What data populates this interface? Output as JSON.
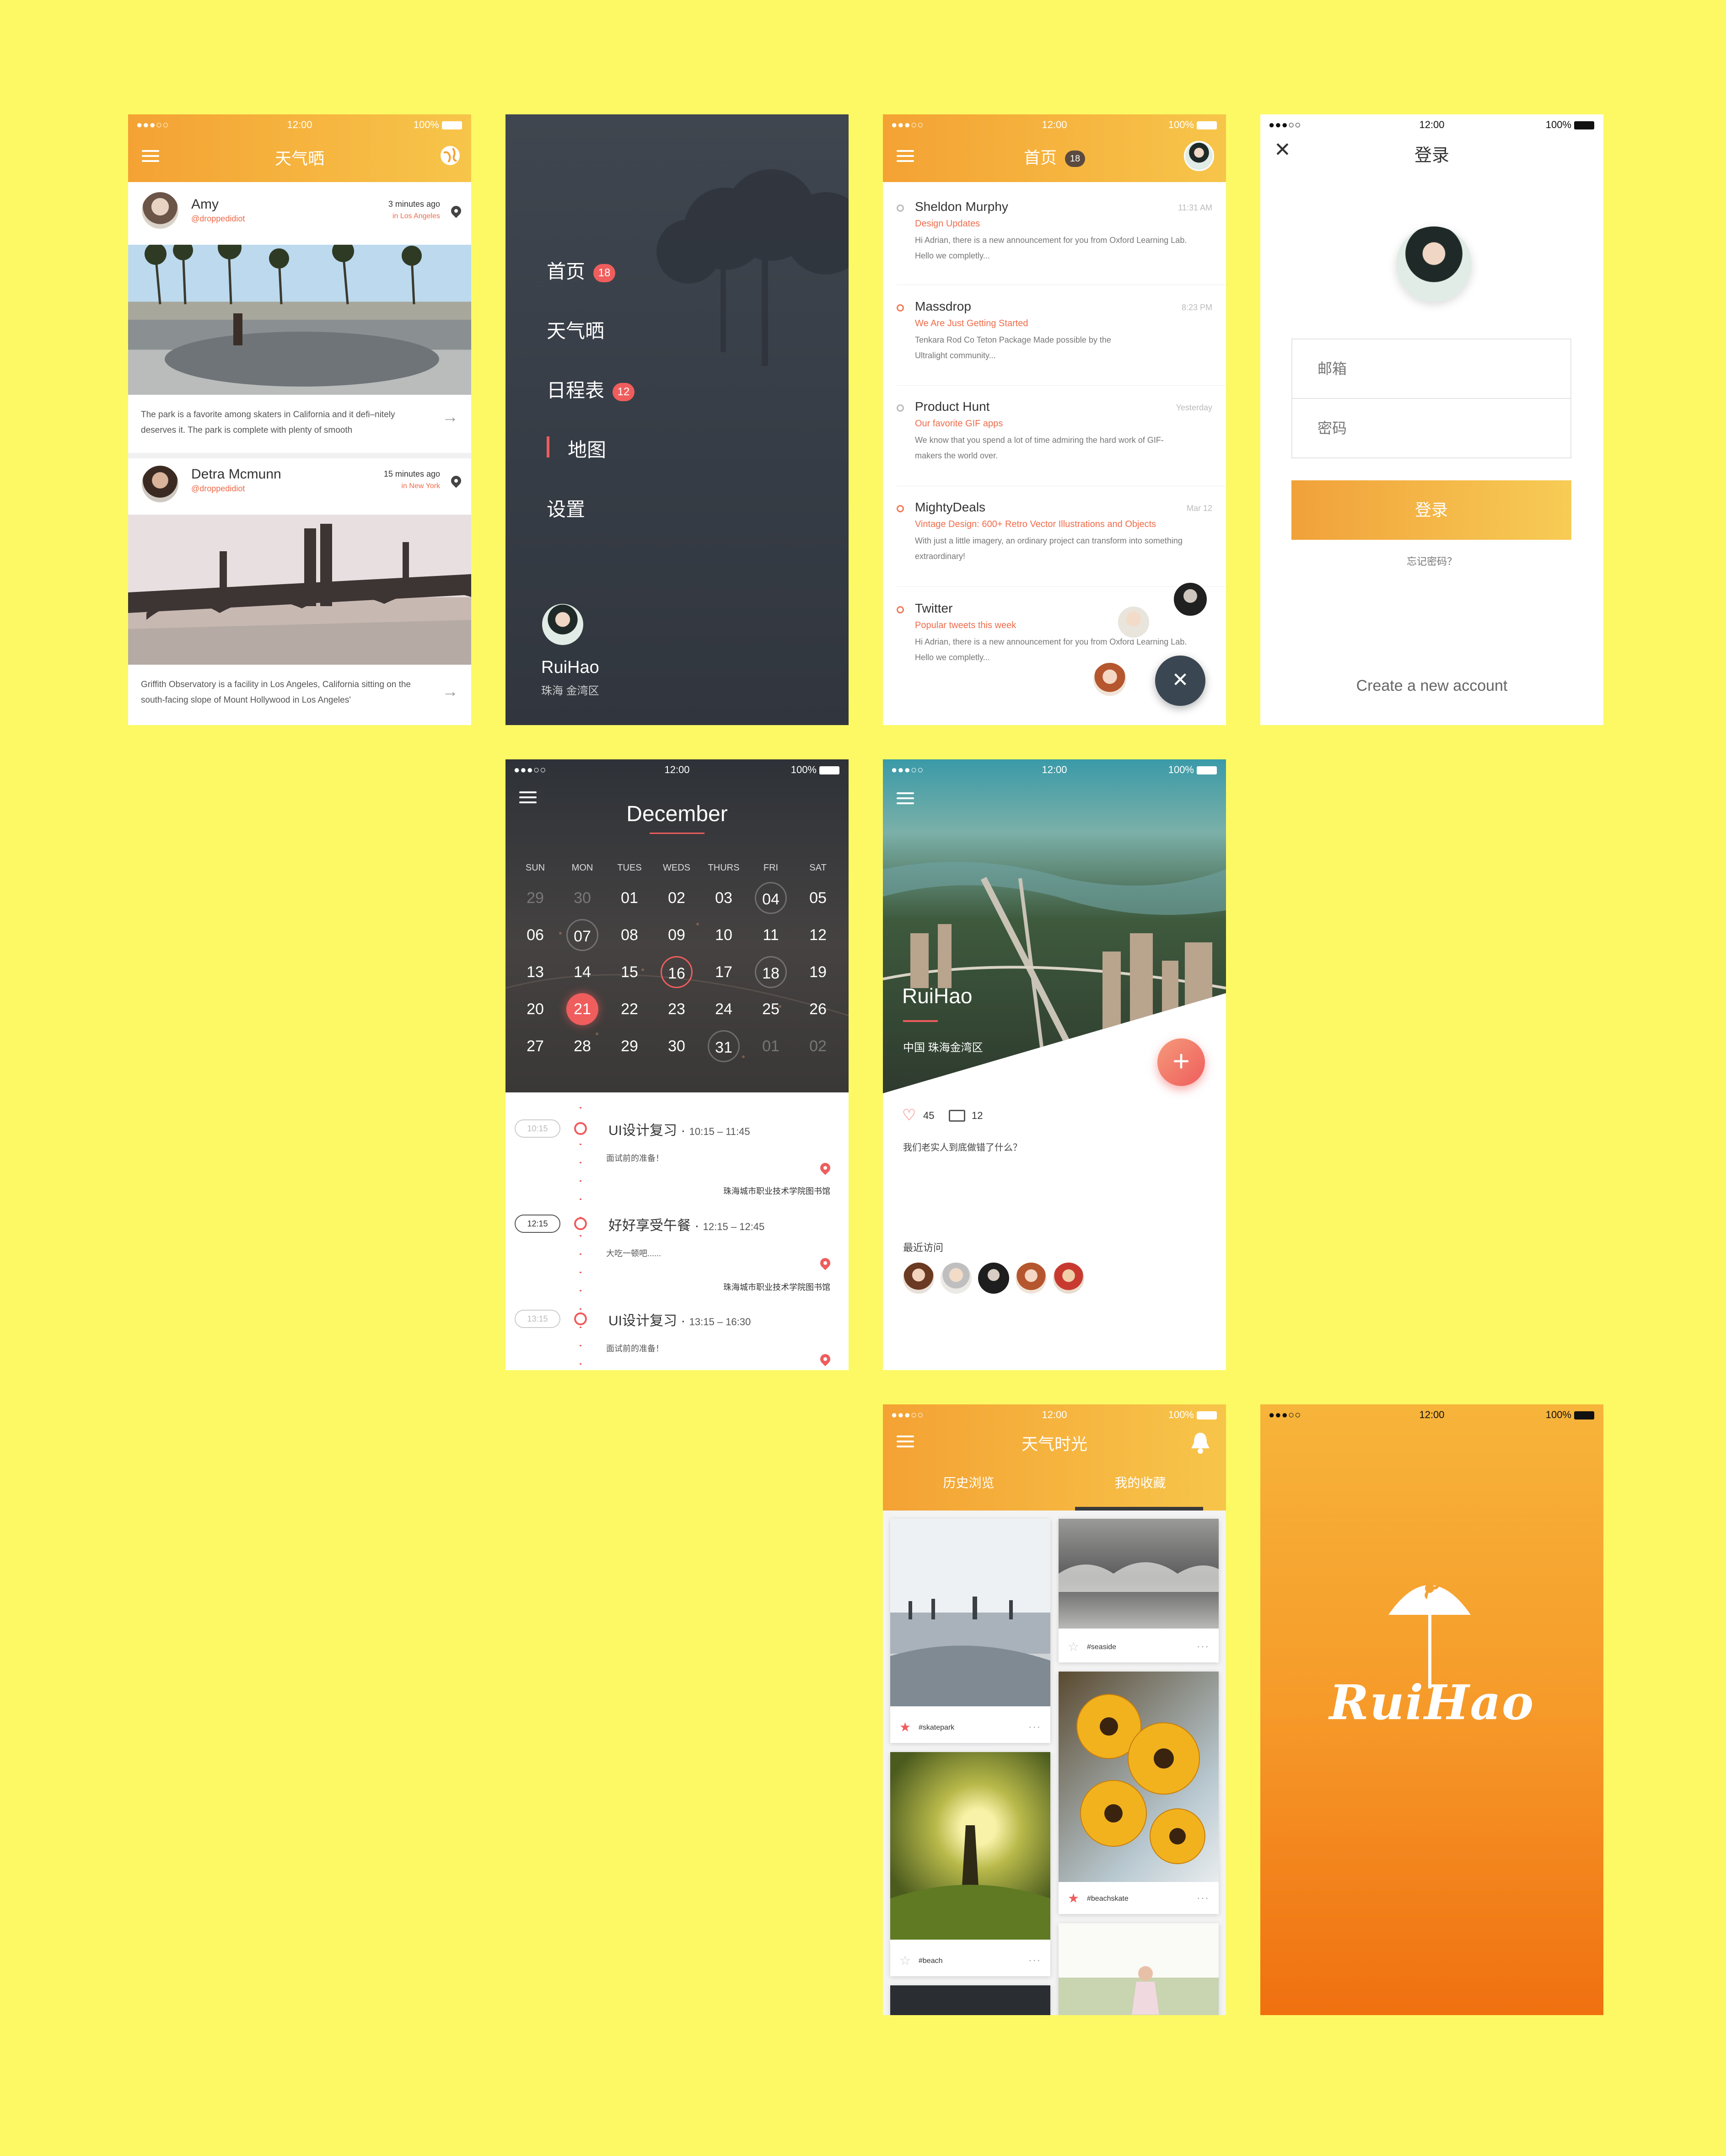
{
  "colors": {
    "background": "#fdf964",
    "orange": "#f4a233",
    "accent_red": "#ef5d5d",
    "dark": "#3a4048"
  },
  "status": {
    "carrier": "●●●○○",
    "time": "12:00",
    "battery": "100%"
  },
  "feed": {
    "title": "天气晒",
    "icons": [
      "menu-icon",
      "globe-icon"
    ],
    "posts": [
      {
        "name": "Amy",
        "handle": "@droppedidiot",
        "time": "3 minutes ago",
        "place": "in Los Angeles",
        "caption": "The park is a favorite among skaters in California and it defi–nitely deserves it. The park is complete with plenty of smooth"
      },
      {
        "name": "Detra Mcmunn",
        "handle": "@droppedidiot",
        "time": "15 minutes ago",
        "place": "in New York",
        "caption": "Griffith Observatory is a facility in Los Angeles, California sitting on the south-facing slope of Mount Hollywood in Los Angeles'"
      }
    ]
  },
  "drawer": {
    "items": [
      {
        "label": "首页",
        "badge": "18"
      },
      {
        "label": "天气晒",
        "badge": ""
      },
      {
        "label": "日程表",
        "badge": "12"
      },
      {
        "label": "地图",
        "badge": "",
        "active": true
      },
      {
        "label": "设置",
        "badge": ""
      }
    ],
    "user_name": "RuiHao",
    "user_location": "珠海 金湾区"
  },
  "inbox": {
    "title": "首页",
    "badge": "18",
    "messages": [
      {
        "name": "Sheldon Murphy",
        "time": "11:31 AM",
        "subject": "Design Updates",
        "body": "Hi Adrian, there is a new announcement for you from Oxford Learning  Lab. Hello we completly..."
      },
      {
        "name": "Massdrop",
        "time": "8:23 PM",
        "subject": "We Are Just Getting Started",
        "body": "Tenkara Rod Co Teton Package Made possible by the Ultralight community..."
      },
      {
        "name": "Product Hunt",
        "time": "Yesterday",
        "subject": "Our favorite GIF apps",
        "body": "We know that you spend a lot of time admiring the hard work of GIF-makers the world over."
      },
      {
        "name": "MightyDeals",
        "time": "Mar 12",
        "subject": "Vintage Design: 600+ Retro Vector Illustrations and Objects",
        "body": "With just a little imagery, an ordinary project can transform into something extraordinary!"
      },
      {
        "name": "Twitter",
        "time": "",
        "subject": "Popular tweets this week",
        "body": "Hi Adrian, there is a new announcement for you from Oxford Learning  Lab. Hello we completly..."
      }
    ],
    "fab_icon": "close-icon"
  },
  "login": {
    "title": "登录",
    "email_placeholder": "邮箱",
    "password_placeholder": "密码",
    "login_button": "登录",
    "forgot": "忘记密码？",
    "create": "Create a new account"
  },
  "calendar": {
    "month": "December",
    "weekdays": [
      "SUN",
      "MON",
      "TUES",
      "WEDS",
      "THURS",
      "FRI",
      "SAT"
    ],
    "weeks": [
      [
        "29",
        "30",
        "01",
        "02",
        "03",
        "04",
        "05"
      ],
      [
        "06",
        "07",
        "08",
        "09",
        "10",
        "11",
        "12"
      ],
      [
        "13",
        "14",
        "15",
        "16",
        "17",
        "18",
        "19"
      ],
      [
        "20",
        "21",
        "22",
        "23",
        "24",
        "25",
        "26"
      ],
      [
        "27",
        "28",
        "29",
        "30",
        "31",
        "01",
        "02"
      ]
    ],
    "events": [
      {
        "chip": "10:15",
        "title": "UI设计复习",
        "range": "10:15 – 11:45",
        "note": "面试前的准备！",
        "location": "珠海城市职业技术学院图书馆"
      },
      {
        "chip": "12:15",
        "title": "好好享受午餐",
        "range": "12:15 – 12:45",
        "note": "大吃一顿吧......",
        "location": "珠海城市职业技术学院图书馆"
      },
      {
        "chip": "13:15",
        "title": "UI设计复习",
        "range": "13:15 – 16:30",
        "note": "面试前的准备！",
        "location": ""
      }
    ]
  },
  "profile": {
    "name": "RuiHao",
    "location": "中国  珠海金湾区",
    "likes": "45",
    "comments": "12",
    "bio": "我们老实人到底做错了什么？",
    "recent_label": "最近访问",
    "fab_icon": "plus-icon"
  },
  "gallery": {
    "title": "天气时光",
    "tabs": [
      "历史浏览",
      "我的收藏"
    ],
    "active_tab": 1,
    "cards": [
      {
        "tag": "#skatepark",
        "starred": true
      },
      {
        "tag": "#seaside",
        "starred": false
      },
      {
        "tag": "#beachskate",
        "starred": true
      },
      {
        "tag": "#beach",
        "starred": false
      }
    ]
  },
  "splash": {
    "brand": "RuiHao",
    "icon": "umbrella-icon"
  }
}
